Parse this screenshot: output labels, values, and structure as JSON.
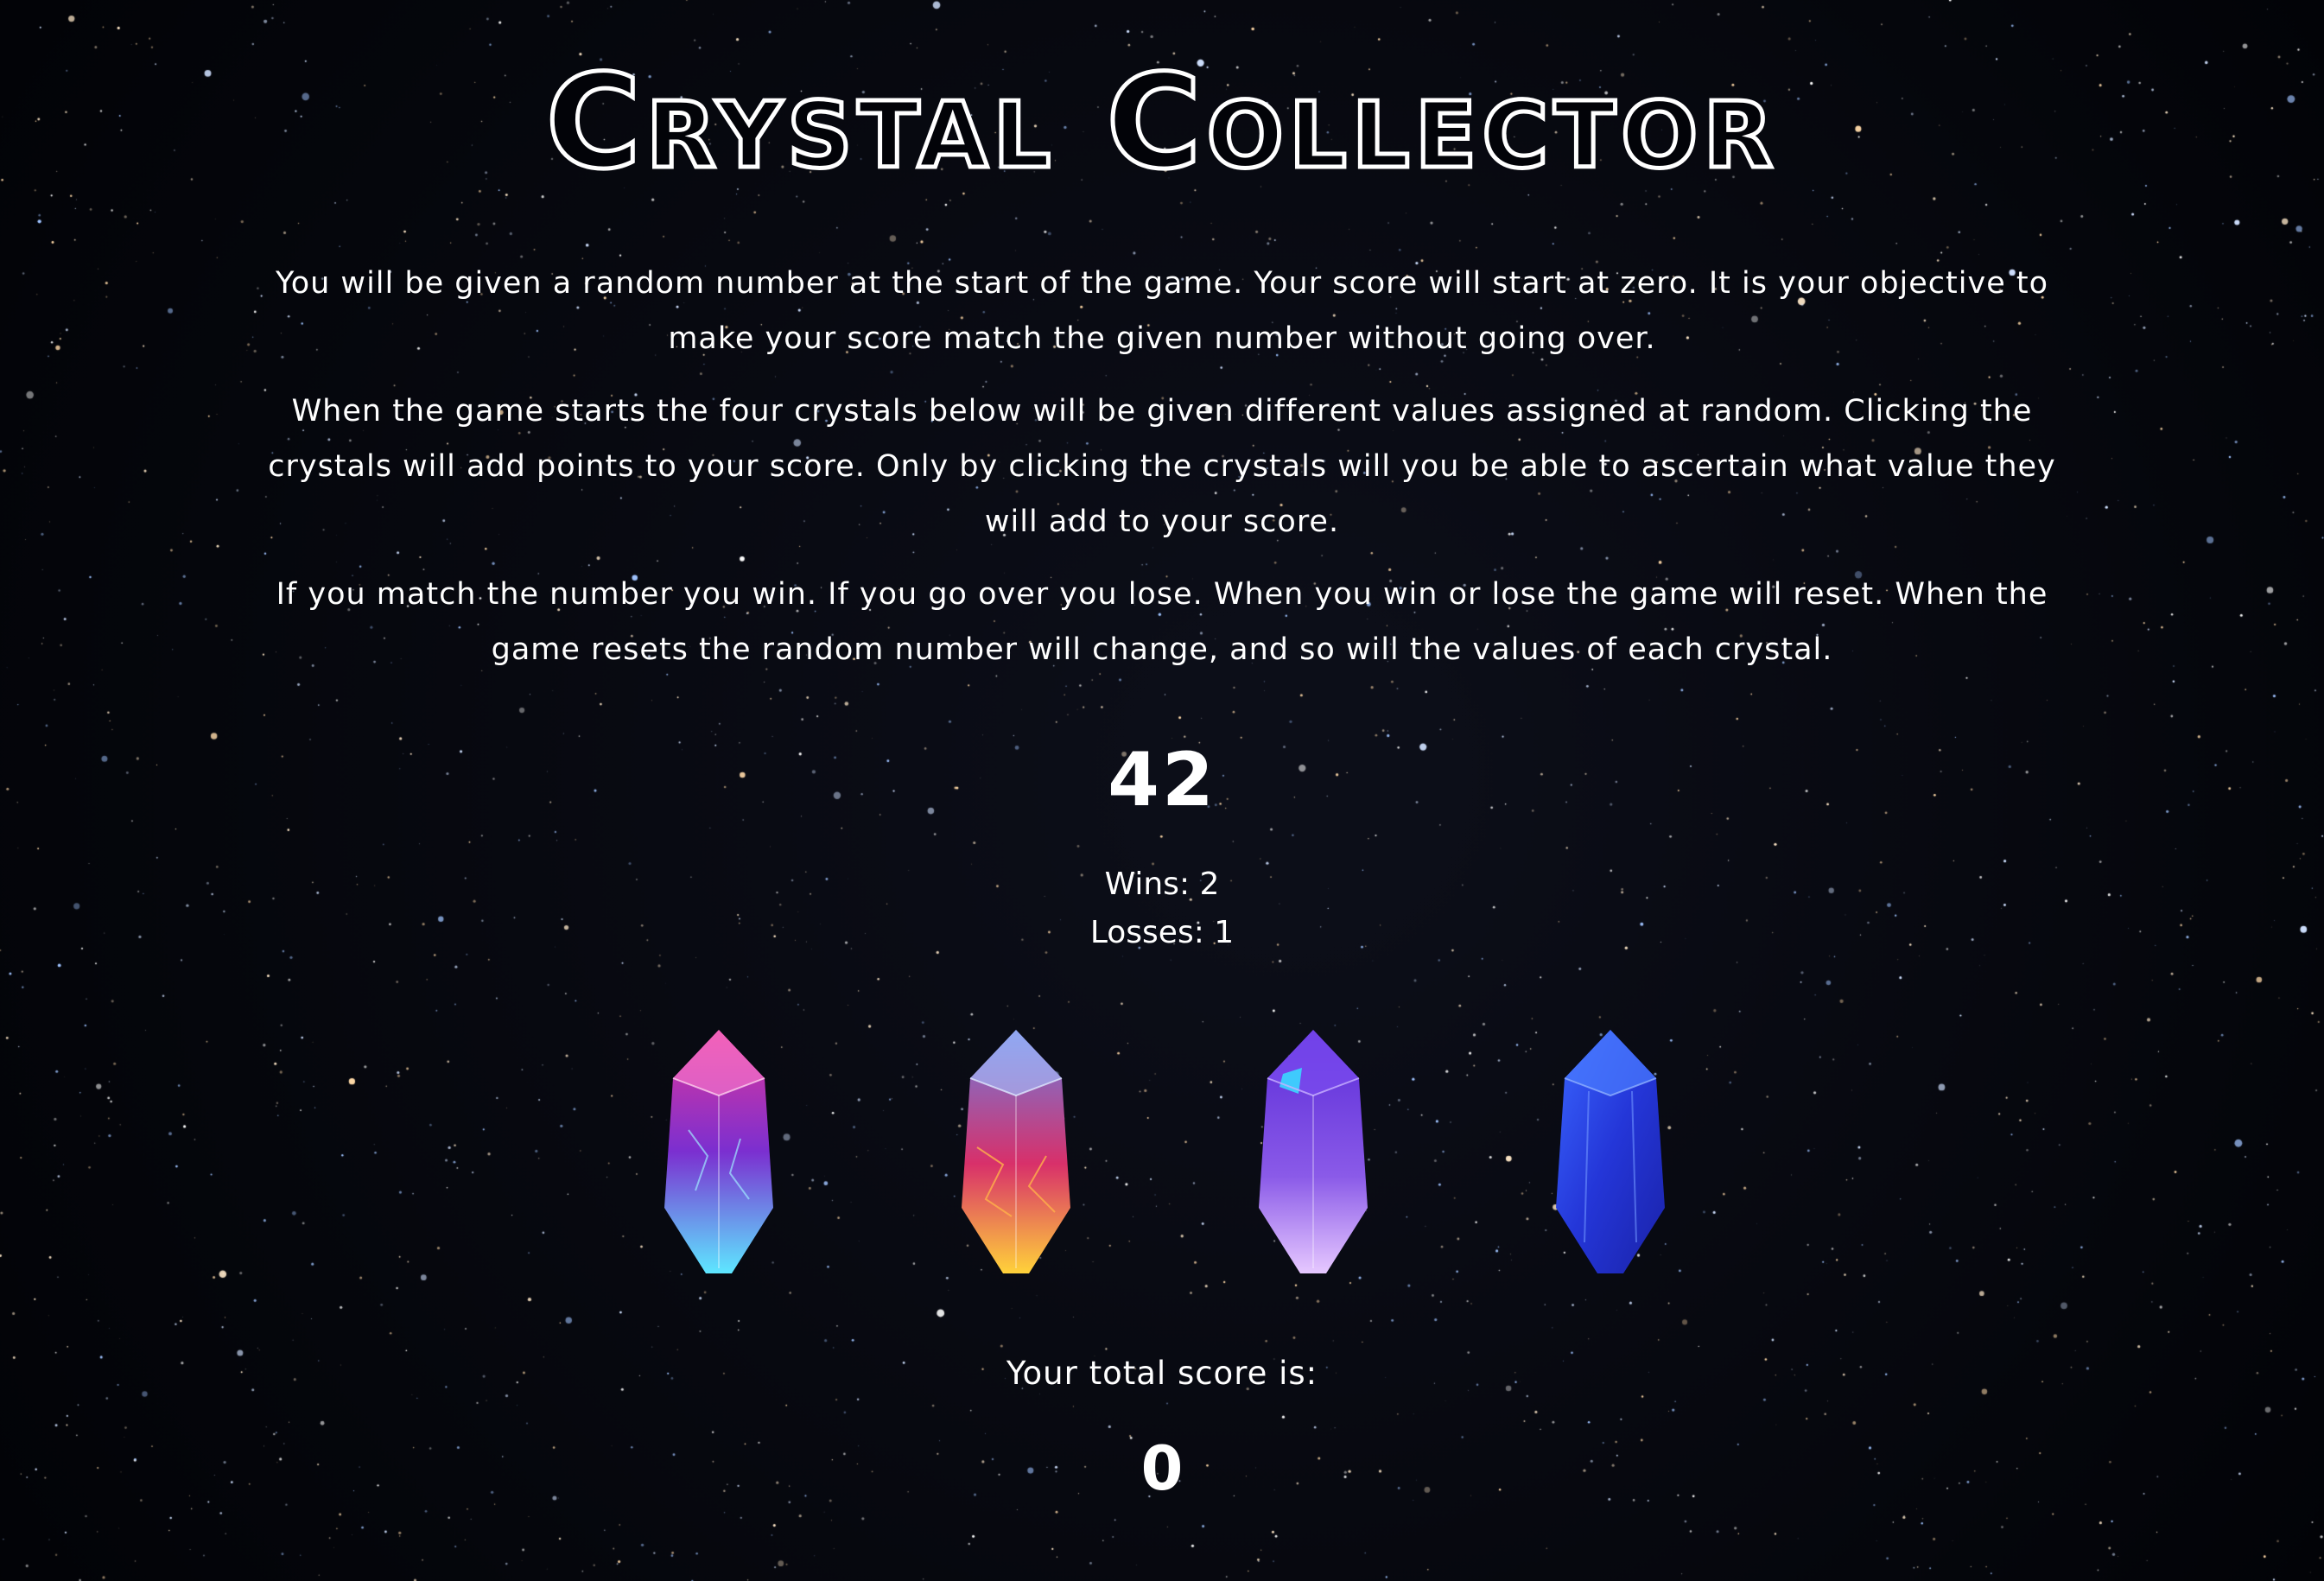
{
  "game": {
    "title": "Crystal Collector",
    "instructions": [
      "You will be given a random number at the start of the game. Your score will start at zero. It is your objective to make your score match the given number without going over.",
      "When the game starts the four crystals below will be given different values assigned at random. Clicking the crystals will add points to your score. Only by clicking the crystals will you be able to ascertain what value they will add to your score.",
      "If you match the number you win. If you go over you lose. When you win or lose the game will reset. When the game resets the random number will change, and so will the values of each crystal."
    ],
    "target_number": "42",
    "wins_text": "Wins: 2",
    "losses_text": "Losses: 1",
    "score_label": "Your total score is:",
    "score_value": "0"
  },
  "crystals": [
    {
      "name": "pink-blue-crystal",
      "colors": [
        "#e0379a",
        "#7b2fd0",
        "#5ee7ff"
      ]
    },
    {
      "name": "red-orange-crystal",
      "colors": [
        "#6a7fe0",
        "#d8306a",
        "#ffd23a"
      ]
    },
    {
      "name": "purple-crystal",
      "colors": [
        "#5a2bd8",
        "#8a5ae8",
        "#e6c8ff"
      ]
    },
    {
      "name": "blue-crystal",
      "colors": [
        "#2436d8",
        "#1a22a8",
        "#3a66ff"
      ]
    }
  ],
  "colors": {
    "background": "#020308",
    "text": "#ffffff"
  }
}
